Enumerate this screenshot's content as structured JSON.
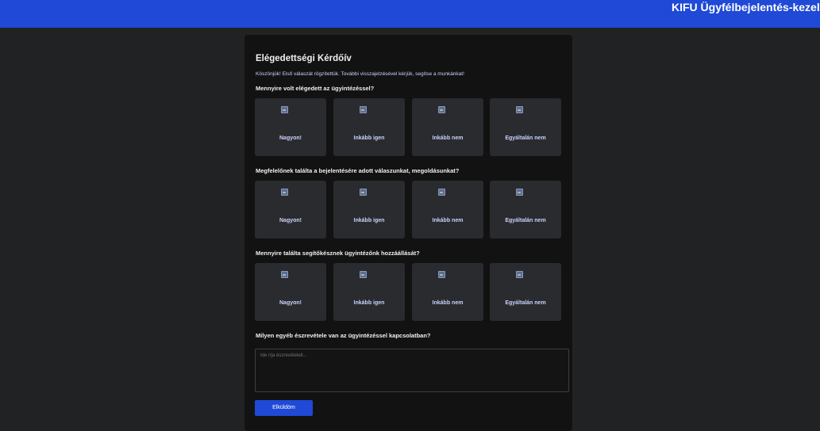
{
  "header": {
    "title": "KIFU Ügyfélbejelentés-kezelő"
  },
  "survey": {
    "title": "Elégedettségi Kérdőív",
    "intro": "Köszönjük! Első válaszát rögzítettük. További visszajelzésével kérjük, segítse a munkánkat!",
    "questions": [
      {
        "text": "Mennyire volt elégedett az ügyintézéssel?",
        "options": [
          "Nagyon!",
          "Inkább igen",
          "Inkább nem",
          "Egyáltalán nem"
        ]
      },
      {
        "text": "Megfelelőnek találta a bejelentésére adott válaszunkat, megoldásunkat?",
        "options": [
          "Nagyon!",
          "Inkább igen",
          "Inkább nem",
          "Egyáltalán nem"
        ]
      },
      {
        "text": "Mennyire találta segítőkésznek ügyintézőnk hozzáállását?",
        "options": [
          "Nagyon!",
          "Inkább igen",
          "Inkább nem",
          "Egyáltalán nem"
        ]
      }
    ],
    "comment": {
      "question": "Milyen egyéb észrevétele van az ügyintézéssel kapcsolatban?",
      "placeholder": "Ide írja észrevételeit..."
    },
    "submit_label": "Elküldöm"
  },
  "colors": {
    "accent": "#1f49d6",
    "card": "#2a2b2e",
    "panel": "#121212",
    "background": "#212223"
  }
}
